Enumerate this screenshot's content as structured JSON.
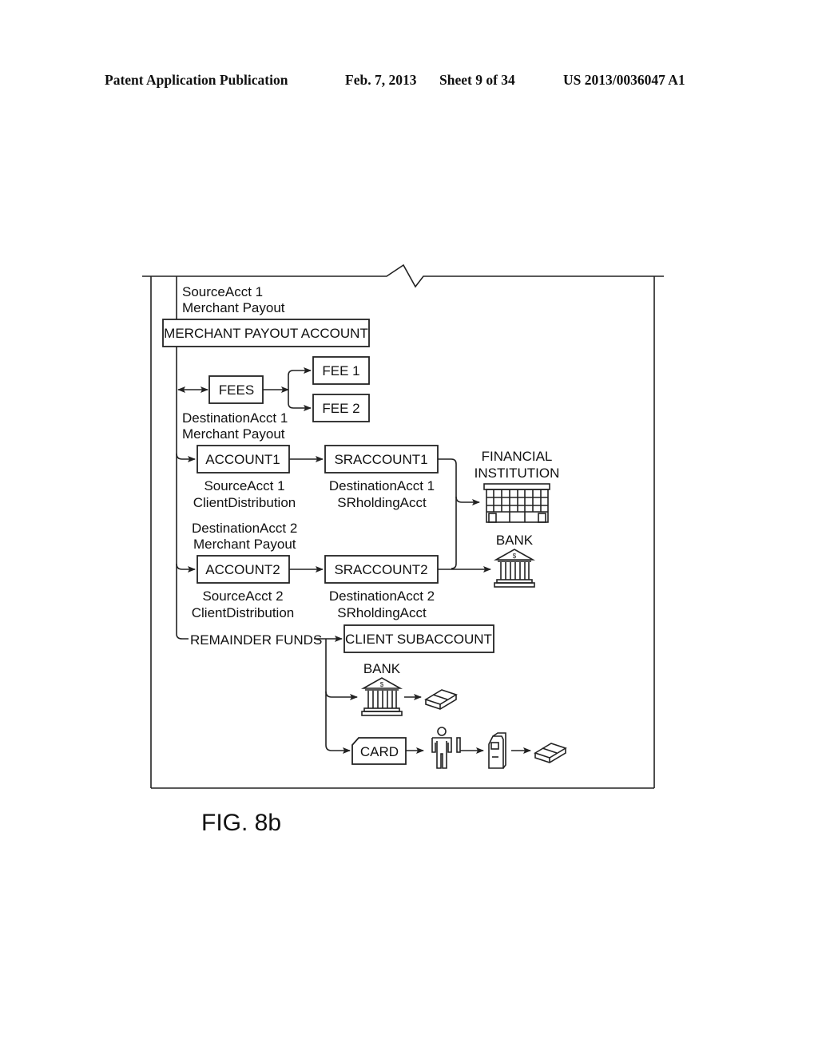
{
  "header": {
    "publication": "Patent Application Publication",
    "date": "Feb. 7, 2013",
    "sheet": "Sheet 9 of 34",
    "number": "US 2013/0036047 A1"
  },
  "diagram": {
    "source_label": [
      "SourceAcct 1",
      "Merchant Payout"
    ],
    "merchant_payout_account": "MERCHANT PAYOUT ACCOUNT",
    "fees": "FEES",
    "fee1": "FEE 1",
    "fee2": "FEE 2",
    "dest1_label": [
      "DestinationAcct 1",
      "Merchant Payout"
    ],
    "account1": "ACCOUNT1",
    "sraccount1": "SRACCOUNT1",
    "account1_sub": [
      "SourceAcct 1",
      "ClientDistribution"
    ],
    "sraccount1_sub": [
      "DestinationAcct 1",
      "SRholdingAcct"
    ],
    "financial_institution": [
      "FINANCIAL",
      "INSTITUTION"
    ],
    "bank_label": "BANK",
    "dest2_label": [
      "DestinationAcct 2",
      "Merchant Payout"
    ],
    "account2": "ACCOUNT2",
    "sraccount2": "SRACCOUNT2",
    "account2_sub": [
      "SourceAcct 2",
      "ClientDistribution"
    ],
    "sraccount2_sub": [
      "DestinationAcct 2",
      "SRholdingAcct"
    ],
    "remainder_funds": "REMAINDER FUNDS",
    "client_subaccount": "CLIENT SUBACCOUNT",
    "bank2_label": "BANK",
    "card": "CARD",
    "icons": [
      "building-icon",
      "bank-icon",
      "cash-icon",
      "person-icon",
      "atm-icon"
    ]
  },
  "figure_label": "FIG. 8b"
}
